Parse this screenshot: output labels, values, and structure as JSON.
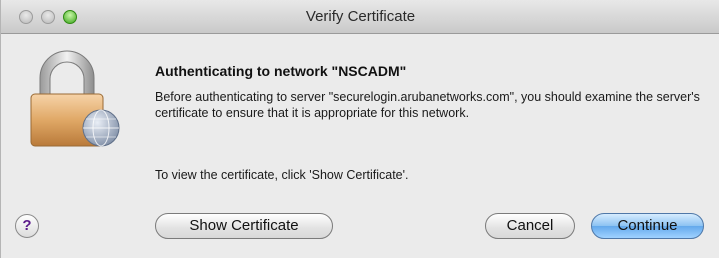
{
  "window": {
    "title": "Verify Certificate",
    "controls": {
      "close": "close-icon",
      "minimize": "minimize-icon",
      "zoom": "zoom-icon"
    }
  },
  "dialog": {
    "icon": "lock-certificate-icon",
    "heading": "Authenticating to network \"NSCADM\"",
    "message": "Before authenticating to server \"securelogin.arubanetworks.com\", you should examine the server's certificate to ensure that it is appropriate for this network.",
    "hint": "To view the certificate, click 'Show Certificate'."
  },
  "buttons": {
    "help": "?",
    "show_certificate": "Show Certificate",
    "cancel": "Cancel",
    "continue": "Continue"
  },
  "colors": {
    "default_button": "#64a9ec",
    "zoom_light": "#3aa51a"
  }
}
